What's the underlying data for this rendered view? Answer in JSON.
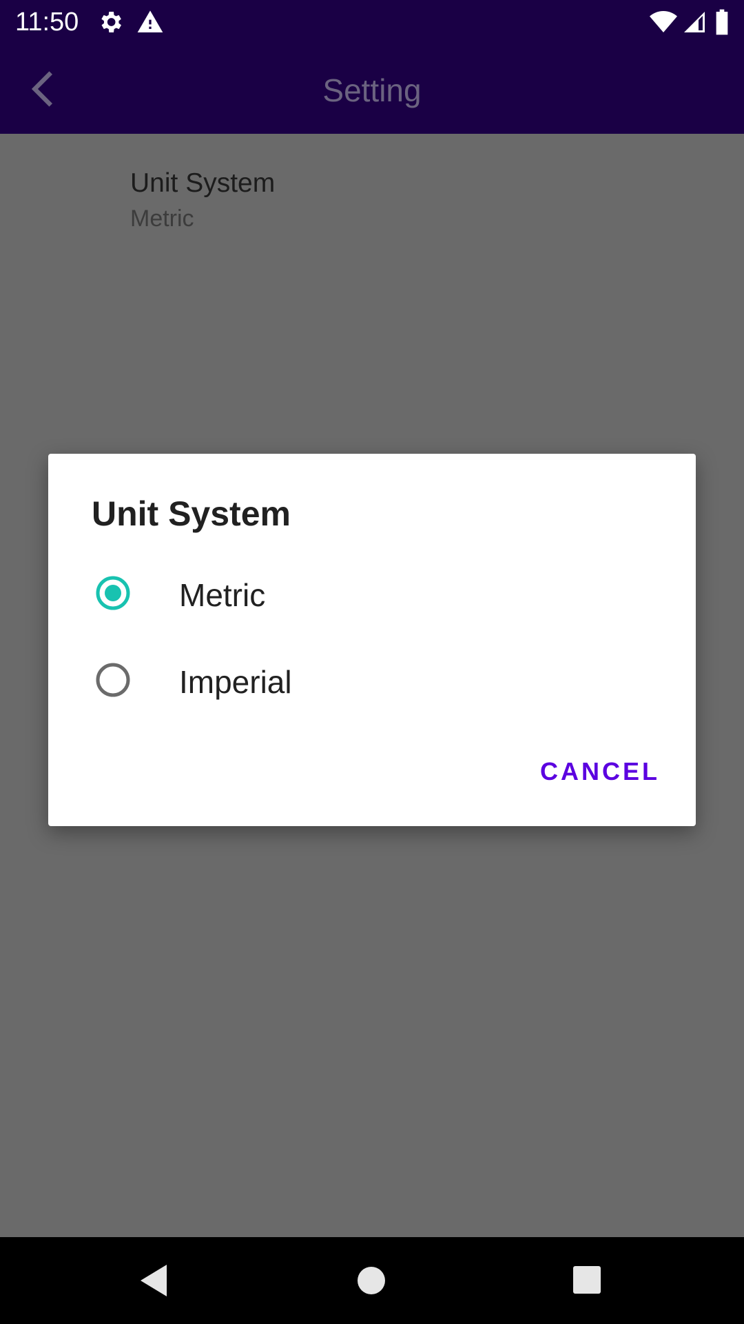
{
  "status_bar": {
    "time": "11:50",
    "icons": [
      "settings-gear-icon",
      "alert-triangle-icon",
      "wifi-icon",
      "cell-signal-icon",
      "battery-icon"
    ]
  },
  "app_bar": {
    "title": "Setting",
    "back_icon": "chevron-left-icon"
  },
  "preference": {
    "title": "Unit System",
    "summary": "Metric"
  },
  "dialog": {
    "title": "Unit System",
    "options": [
      {
        "label": "Metric",
        "selected": true
      },
      {
        "label": "Imperial",
        "selected": false
      }
    ],
    "cancel_label": "CANCEL"
  },
  "nav_bar": {
    "icons": [
      "nav-back-icon",
      "nav-home-icon",
      "nav-recents-icon"
    ]
  },
  "colors": {
    "app_bar": "#1a0045",
    "radio_selected": "#18c2b0",
    "accent_text": "#5b00e0",
    "scrim": "#6a6a6a"
  }
}
